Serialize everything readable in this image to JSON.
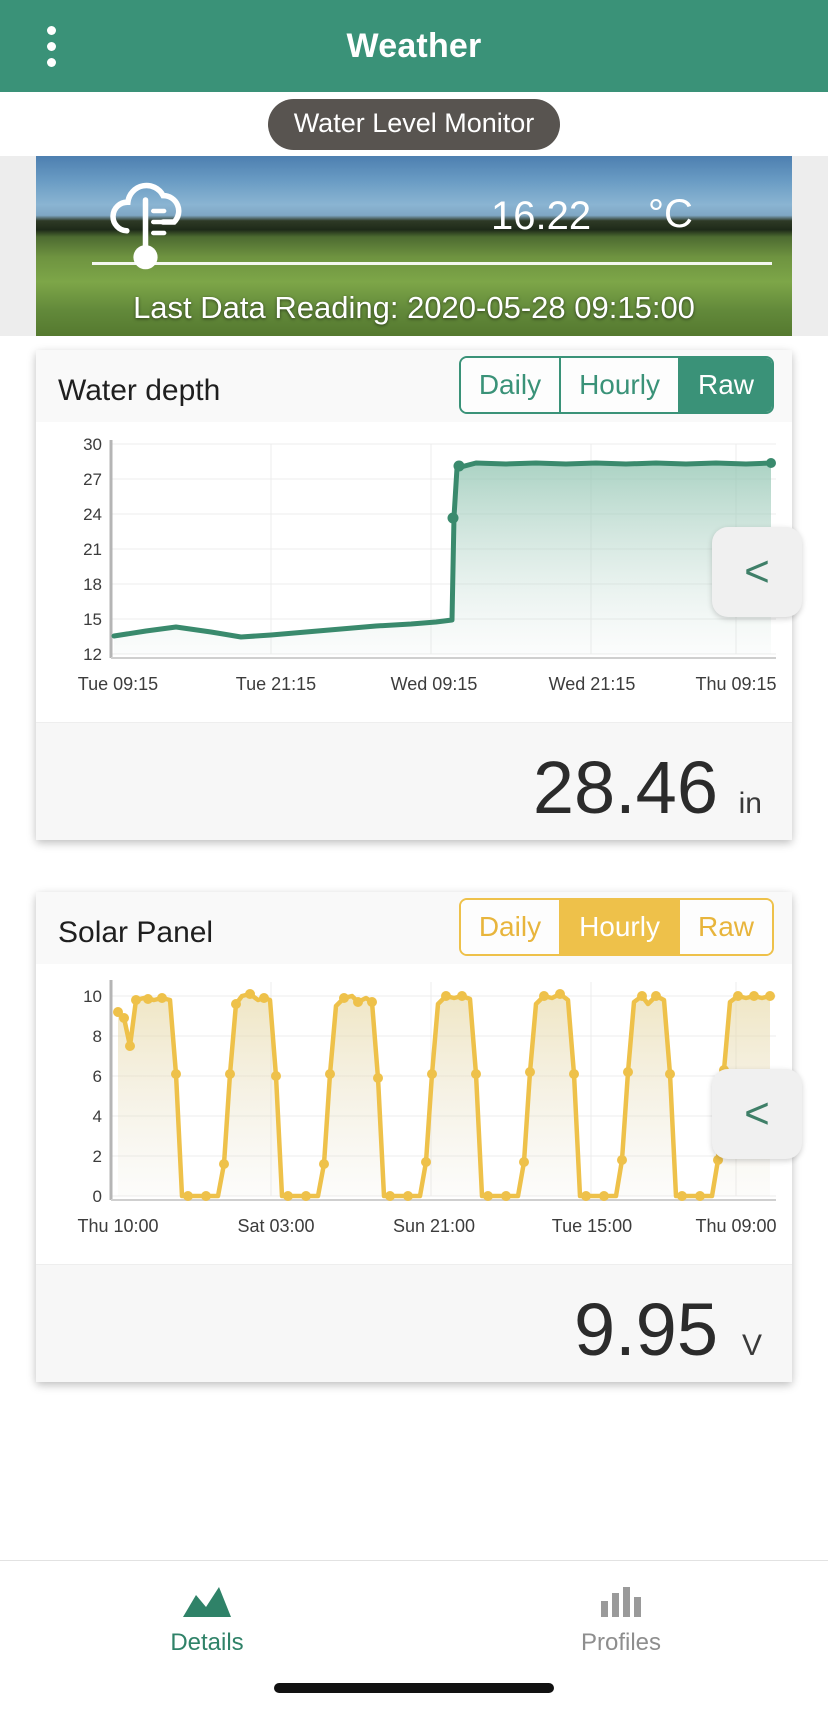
{
  "appbar": {
    "title": "Weather",
    "menu_icon": "kebab-menu-icon"
  },
  "device": {
    "name": "Water Level Monitor"
  },
  "hero": {
    "icon": "cloud-thermometer-icon",
    "temperature": "16.22",
    "temperature_unit": "°C",
    "last_reading_label": "Last Data Reading: 2020-05-28 09:15:00"
  },
  "colors": {
    "primary_green": "#3a9278",
    "appbar_green": "#3a9278",
    "amber": "#eec14a",
    "pill_gray": "#585450"
  },
  "cards": [
    {
      "title": "Water depth",
      "accent": "#3a9278",
      "segments": [
        {
          "label": "Daily",
          "selected": false
        },
        {
          "label": "Hourly",
          "selected": false
        },
        {
          "label": "Raw",
          "selected": true
        }
      ],
      "prev_icon": "chevron-left-icon",
      "value": "28.46",
      "unit": "in"
    },
    {
      "title": "Solar Panel",
      "accent": "#eec14a",
      "segments": [
        {
          "label": "Daily",
          "selected": false
        },
        {
          "label": "Hourly",
          "selected": true
        },
        {
          "label": "Raw",
          "selected": false
        }
      ],
      "prev_icon": "chevron-left-icon",
      "value": "9.95",
      "unit": "V"
    }
  ],
  "bottom_nav": [
    {
      "label": "Details",
      "icon": "area-chart-icon",
      "active": true
    },
    {
      "label": "Profiles",
      "icon": "bar-chart-icon",
      "active": false
    }
  ],
  "chart_data": [
    {
      "type": "area",
      "title": "Water depth",
      "xlabel": "",
      "ylabel": "",
      "ylim": [
        12,
        30
      ],
      "yticks": [
        12,
        15,
        18,
        21,
        24,
        27,
        30
      ],
      "xticks": [
        "Tue 09:15",
        "Tue 21:15",
        "Wed 09:15",
        "Wed 21:15",
        "Thu 09:15"
      ],
      "grid": true,
      "legend": "none",
      "unit": "in",
      "current_value": 28.46,
      "series": [
        {
          "name": "Water depth",
          "color": "#3a8a6d",
          "x": [
            "Tue 09:15",
            "Tue 11:15",
            "Tue 13:15",
            "Tue 15:15",
            "Tue 17:15",
            "Tue 19:15",
            "Tue 21:15",
            "Tue 23:15",
            "Wed 01:15",
            "Wed 03:15",
            "Wed 05:15",
            "Wed 07:15",
            "Wed 08:15",
            "Wed 08:45",
            "Wed 09:15",
            "Wed 09:45",
            "Wed 10:15",
            "Wed 12:15",
            "Wed 15:15",
            "Wed 18:15",
            "Wed 21:15",
            "Thu 00:15",
            "Thu 03:15",
            "Thu 06:15",
            "Thu 09:15"
          ],
          "values": [
            13.6,
            13.3,
            13.0,
            12.8,
            12.75,
            12.8,
            12.9,
            13.0,
            13.1,
            13.2,
            13.3,
            13.3,
            13.35,
            13.4,
            13.4,
            20.5,
            26.2,
            28.7,
            28.7,
            28.6,
            28.65,
            28.6,
            28.55,
            28.5,
            28.46
          ]
        }
      ]
    },
    {
      "type": "line",
      "title": "Solar Panel",
      "xlabel": "",
      "ylabel": "",
      "ylim": [
        0,
        11
      ],
      "yticks": [
        0,
        2,
        4,
        6,
        8,
        10
      ],
      "xticks": [
        "Thu 10:00",
        "Sat 03:00",
        "Sun 21:00",
        "Tue 15:00",
        "Thu 09:00"
      ],
      "grid": true,
      "legend": "none",
      "unit": "V",
      "current_value": 9.95,
      "series": [
        {
          "name": "Solar Panel voltage",
          "color": "#eec14a",
          "x": [
            "d1-06",
            "d1-08",
            "d1-09",
            "d1-10",
            "d1-11",
            "d1-12",
            "d1-14",
            "d1-16",
            "d1-18",
            "d1-19",
            "d1-20",
            "d1-22",
            "d2-00",
            "d2-04",
            "d2-06",
            "d2-07",
            "d2-08",
            "d2-09",
            "d2-10",
            "d2-12",
            "d2-14",
            "d2-16",
            "d2-18",
            "d2-19",
            "d2-20",
            "d2-22",
            "d3-00",
            "d3-04",
            "d3-06",
            "d3-07",
            "d3-08",
            "d3-09",
            "d3-10",
            "d3-12",
            "d3-14",
            "d3-16",
            "d3-18",
            "d3-19",
            "d3-20",
            "d3-22",
            "d4-00",
            "d4-04",
            "d4-06",
            "d4-07",
            "d4-08",
            "d4-09",
            "d4-10",
            "d4-12",
            "d4-14",
            "d4-16",
            "d4-18",
            "d4-19",
            "d4-20",
            "d4-22",
            "d5-00",
            "d5-04",
            "d5-06",
            "d5-07",
            "d5-08",
            "d5-09",
            "d5-10",
            "d5-12",
            "d5-14",
            "d5-16",
            "d5-18",
            "d5-19",
            "d5-20",
            "d5-22",
            "d6-00",
            "d6-04",
            "d6-06",
            "d6-07",
            "d6-08",
            "d6-09",
            "d6-10",
            "d6-12",
            "d6-14",
            "d6-16",
            "d6-18",
            "d6-19",
            "d6-20",
            "d6-22",
            "d7-00",
            "d7-04",
            "d7-06",
            "d7-07",
            "d7-08",
            "d7-09"
          ],
          "values": [
            9.2,
            8.9,
            7.3,
            9.9,
            10.0,
            9.9,
            10.0,
            9.9,
            6.3,
            2.9,
            0.1,
            0.0,
            0.0,
            0.0,
            0.2,
            6.2,
            9.8,
            10.0,
            10.2,
            10.0,
            9.9,
            10.0,
            6.2,
            2.9,
            0.1,
            0.0,
            0.0,
            0.0,
            0.2,
            6.2,
            9.5,
            9.9,
            10.0,
            9.9,
            9.7,
            9.8,
            6.0,
            2.8,
            0.1,
            0.0,
            0.0,
            0.0,
            0.2,
            6.0,
            9.6,
            9.9,
            10.0,
            10.0,
            9.9,
            9.9,
            6.1,
            2.9,
            0.1,
            0.0,
            0.0,
            0.0,
            0.2,
            6.1,
            9.5,
            9.9,
            10.0,
            10.0,
            9.9,
            9.9,
            6.1,
            2.9,
            0.1,
            0.0,
            0.0,
            0.0,
            0.2,
            6.4,
            9.4,
            10.1,
            9.7,
            10.1,
            9.9,
            9.8,
            6.1,
            2.9,
            0.1,
            0.0,
            0.0,
            0.0,
            0.2,
            6.3,
            9.4,
            9.95
          ]
        }
      ]
    }
  ]
}
